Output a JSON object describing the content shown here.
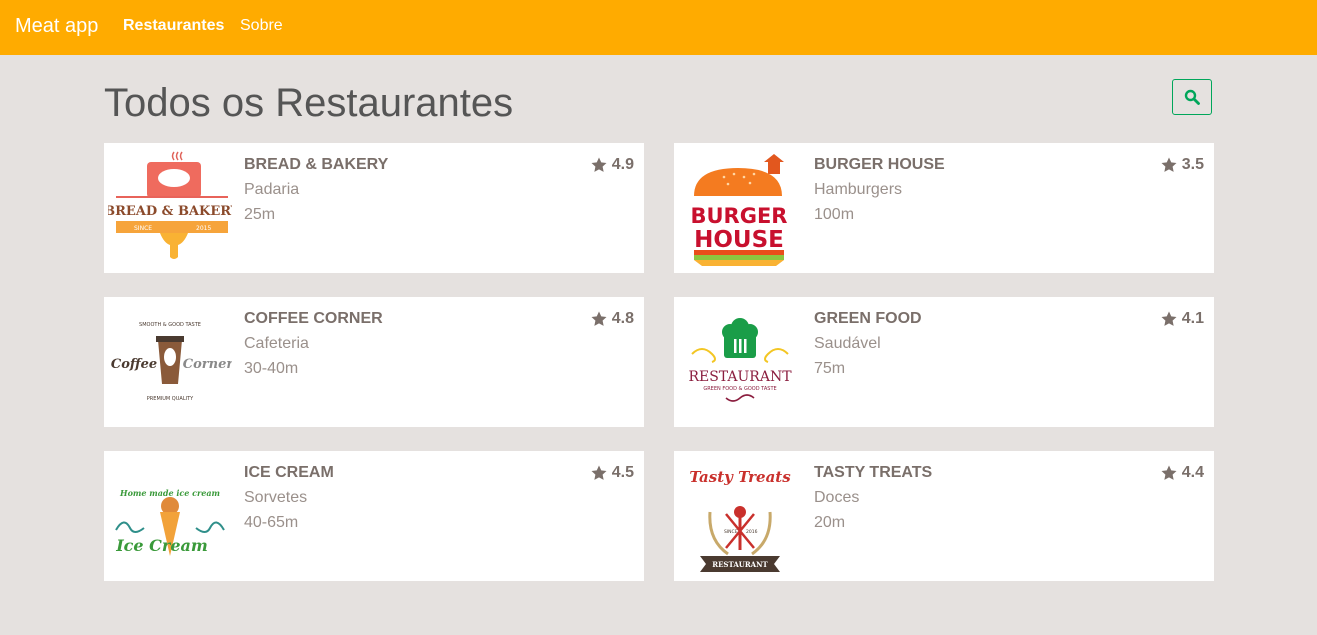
{
  "navbar": {
    "brand": "Meat app",
    "links": [
      {
        "label": "Restaurantes",
        "active": true
      },
      {
        "label": "Sobre",
        "active": false
      }
    ],
    "color": "#ffab00"
  },
  "page": {
    "title": "Todos os Restaurantes",
    "search_icon": "search-icon",
    "accent": "#00a65a"
  },
  "restaurants": [
    {
      "name": "BREAD & BAKERY",
      "category": "Padaria",
      "delivery": "25m",
      "rating": "4.9",
      "logo": {
        "line1": "BREAD & BAKERY",
        "line2": "SINCE",
        "line3": "2015"
      }
    },
    {
      "name": "BURGER HOUSE",
      "category": "Hamburgers",
      "delivery": "100m",
      "rating": "3.5",
      "logo": {
        "line1": "BURGER",
        "line2": "HOUSE"
      }
    },
    {
      "name": "COFFEE CORNER",
      "category": "Cafeteria",
      "delivery": "30-40m",
      "rating": "4.8",
      "logo": {
        "line1": "Coffee",
        "line2": "Corner",
        "line3": "SMOOTH & GOOD TASTE",
        "line4": "PREMIUM QUALITY"
      }
    },
    {
      "name": "GREEN FOOD",
      "category": "Saudável",
      "delivery": "75m",
      "rating": "4.1",
      "logo": {
        "line1": "RESTAURANT",
        "line2": "GREEN FOOD & GOOD TASTE"
      }
    },
    {
      "name": "ICE CREAM",
      "category": "Sorvetes",
      "delivery": "40-65m",
      "rating": "4.5",
      "logo": {
        "line1": "Home made ice cream",
        "line2": "Ice Cream"
      }
    },
    {
      "name": "TASTY TREATS",
      "category": "Doces",
      "delivery": "20m",
      "rating": "4.4",
      "logo": {
        "line1": "Tasty Treats",
        "line2": "SINCE",
        "line3": "2016",
        "line4": "RESTAURANT"
      }
    }
  ]
}
